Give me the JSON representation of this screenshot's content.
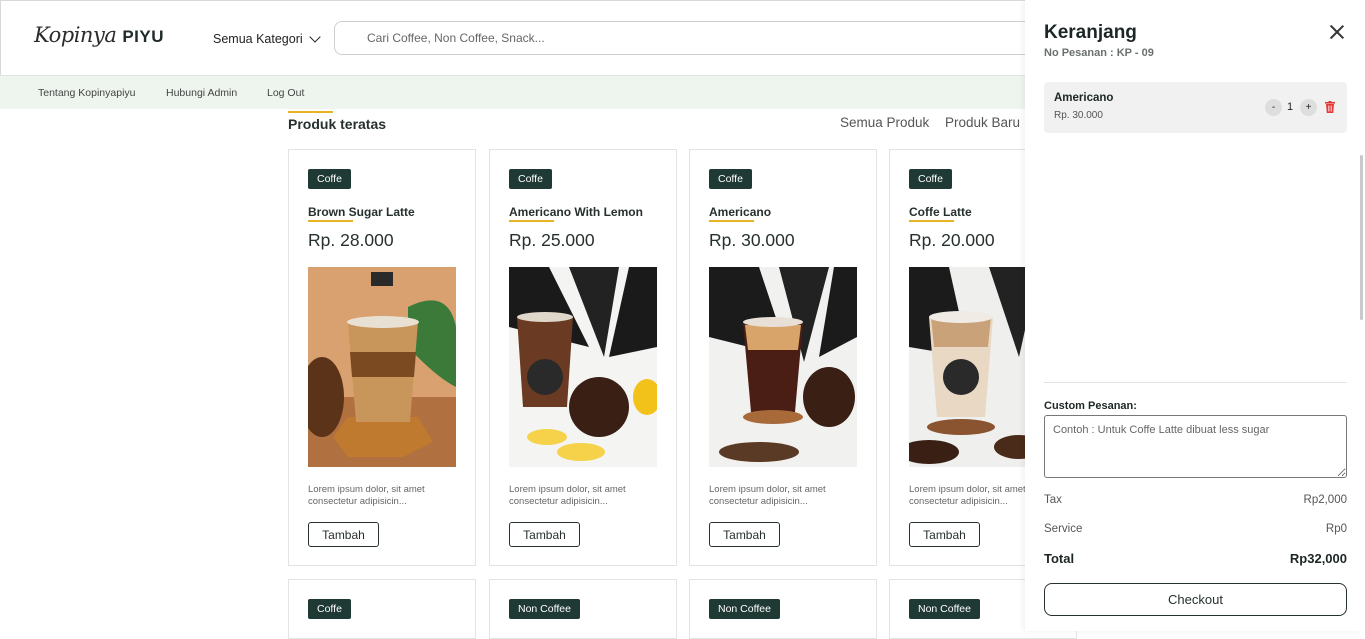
{
  "brand": {
    "script": "Kopinya",
    "bold": "PIYU"
  },
  "header": {
    "category_label": "Semua Kategori",
    "search_placeholder": "Cari Coffee, Non Coffee, Snack..."
  },
  "subnav": [
    "Tentang Kopinyapiyu",
    "Hubungi Admin",
    "Log Out"
  ],
  "section": {
    "title": "Produk teratas",
    "tabs": [
      "Semua Produk",
      "Produk Baru"
    ]
  },
  "products": [
    {
      "badge": "Coffe",
      "name": "Brown Sugar Latte",
      "price": "Rp. 28.000",
      "desc": "Lorem ipsum dolor, sit amet consectetur adipisicin...",
      "button": "Tambah"
    },
    {
      "badge": "Coffe",
      "name": "Americano With Lemon",
      "price": "Rp. 25.000",
      "desc": "Lorem ipsum dolor, sit amet consectetur adipisicin...",
      "button": "Tambah"
    },
    {
      "badge": "Coffe",
      "name": "Americano",
      "price": "Rp. 30.000",
      "desc": "Lorem ipsum dolor, sit amet consectetur adipisicin...",
      "button": "Tambah"
    },
    {
      "badge": "Coffe",
      "name": "Coffe Latte",
      "price": "Rp. 20.000",
      "desc": "Lorem ipsum dolor, sit amet consectetur adipisicin...",
      "button": "Tambah"
    }
  ],
  "products_row2": [
    {
      "badge": "Coffe"
    },
    {
      "badge": "Non Coffee"
    },
    {
      "badge": "Non Coffee"
    },
    {
      "badge": "Non Coffee"
    }
  ],
  "cart": {
    "title": "Keranjang",
    "order_no": "No Pesanan : KP - 09",
    "item": {
      "name": "Americano",
      "price": "Rp. 30.000",
      "minus": "-",
      "qty": "1",
      "plus": "+"
    },
    "custom_label": "Custom Pesanan:",
    "custom_placeholder": "Contoh : Untuk Coffe Latte dibuat less sugar",
    "tax_label": "Tax",
    "tax_value": "Rp2,000",
    "service_label": "Service",
    "service_value": "Rp0",
    "total_label": "Total",
    "total_value": "Rp32,000",
    "checkout": "Checkout"
  },
  "colors": {
    "badge": "#1f3a34",
    "accent": "#e6b325",
    "subnav_bg": "#eef5ee",
    "delete": "#e53935"
  }
}
